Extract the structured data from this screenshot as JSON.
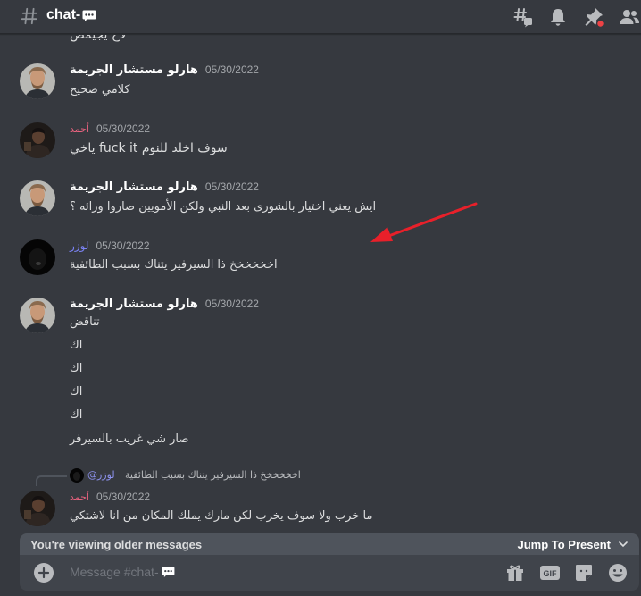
{
  "header": {
    "channel_name": "chat-",
    "icons": [
      "threads-icon",
      "bell-icon",
      "pin-icon",
      "members-icon"
    ]
  },
  "cut_off_text": "لاخ يجيمض",
  "messages": [
    {
      "author": "هارلو مستشار الجريمة",
      "timestamp": "05/30/2022",
      "lines": [
        "كلامي صحيح"
      ]
    },
    {
      "author": "أحمد",
      "timestamp": "05/30/2022",
      "lines": [
        "ياخي fuck it سوف اخلد للنوم"
      ]
    },
    {
      "author": "هارلو مستشار الجريمة",
      "timestamp": "05/30/2022",
      "lines": [
        "ايش يعني اختيار بالشورى بعد النبي ولكن الأمويين صاروا ورائه ؟"
      ]
    },
    {
      "author": "لوزر",
      "timestamp": "05/30/2022",
      "lines": [
        "اخخخخخخ ذا السيرفير يتناك بسبب الطائفية"
      ]
    },
    {
      "author": "هارلو مستشار الجريمة",
      "timestamp": "05/30/2022",
      "lines": [
        "تناقض",
        "اك",
        "اك",
        "اك",
        "اك",
        "صار شي غريب بالسيرفر"
      ]
    },
    {
      "reply_mention": "@لوزر",
      "reply_text": "اخخخخخخ ذا السيرفير يتناك بسبب الطائفية",
      "author": "أحمد",
      "timestamp": "05/30/2022",
      "lines": [
        "ما خرب ولا سوف يخرب لكن مارك يملك المكان من انا لاشتكي"
      ]
    }
  ],
  "older_bar": {
    "text": "You're viewing older messages",
    "jump_label": "Jump To Present"
  },
  "composer": {
    "placeholder": "Message #chat-",
    "icons": [
      "gift-icon",
      "gif-icon",
      "sticker-icon",
      "emoji-icon"
    ]
  },
  "colors": {
    "background": "#36393f",
    "author_white": "#ffffff",
    "author_pink": "#e9637f",
    "author_blue": "#7b83f6",
    "arrow_red": "#e8202a"
  }
}
